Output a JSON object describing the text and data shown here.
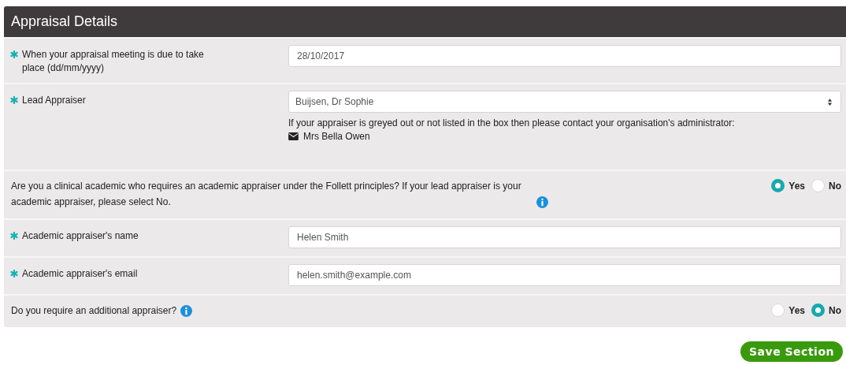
{
  "panel": {
    "title": "Appraisal Details"
  },
  "rows": [
    {
      "kind": "input",
      "required": true,
      "label": "When your appraisal meeting is due to take place (dd/mm/yyyy)",
      "value": "28/10/2017"
    },
    {
      "kind": "select",
      "required": true,
      "label": "Lead Appraiser",
      "value": "Buijsen, Dr Sophie",
      "help": "If your appraiser is greyed out or not listed in the box then please contact your organisation's administrator:",
      "contact": "Mrs Bella Owen"
    },
    {
      "kind": "radio",
      "label": "Are you a clinical academic who requires an academic appraiser under the Follett principles? If your lead appraiser is your academic appraiser, please select No.",
      "info": true,
      "options": [
        {
          "label": "Yes",
          "selected": true
        },
        {
          "label": "No",
          "selected": false
        }
      ]
    },
    {
      "kind": "input",
      "required": true,
      "label": "Academic appraiser's name",
      "value": "Helen Smith"
    },
    {
      "kind": "input",
      "required": true,
      "label": "Academic appraiser's email",
      "value": "helen.smith@example.com"
    },
    {
      "kind": "radio",
      "label": "Do you require an additional appraiser?",
      "info": true,
      "options": [
        {
          "label": "Yes",
          "selected": false
        },
        {
          "label": "No",
          "selected": true
        }
      ]
    }
  ],
  "save_button": "Save Section"
}
